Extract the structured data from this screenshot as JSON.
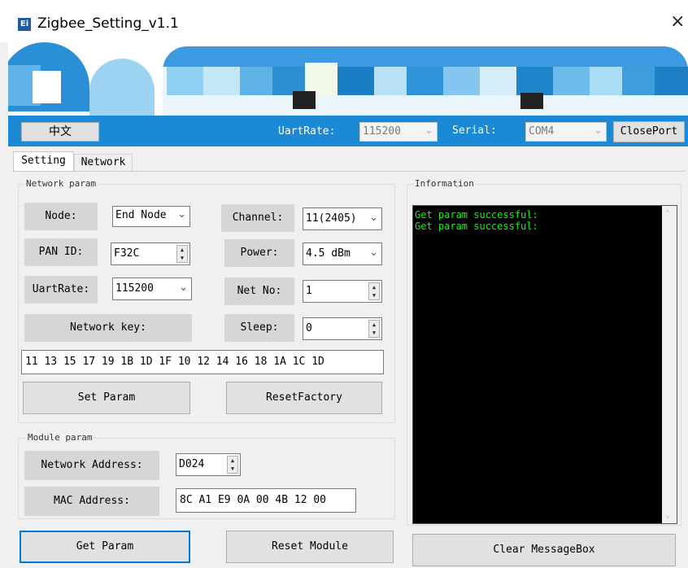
{
  "window": {
    "title": "Zigbee_Setting_v1.1",
    "close_glyph": "×",
    "app_icon": "Ei"
  },
  "toolbar": {
    "language_button": "中文",
    "uartrate_label": "UartRate:",
    "uartrate_value": "115200",
    "serial_label": "Serial:",
    "serial_value": "COM4",
    "close_port_button": "ClosePort",
    "accent": "#1b89d6"
  },
  "tabs": [
    {
      "label": "Setting"
    },
    {
      "label": "Network"
    }
  ],
  "network_param": {
    "title": "Network param",
    "node_label": "Node:",
    "node_value": "End Node",
    "channel_label": "Channel:",
    "channel_value": "11(2405)",
    "panid_label": "PAN ID:",
    "panid_value": "F32C",
    "power_label": "Power:",
    "power_value": "4.5 dBm",
    "uartrate_label": "UartRate:",
    "uartrate_value": "115200",
    "netno_label": "Net No:",
    "netno_value": "1",
    "network_key_label": "Network key:",
    "sleep_label": "Sleep:",
    "sleep_value": "0",
    "network_key_value": "11 13 15 17 19 1B 1D 1F 10 12 14 16 18 1A 1C 1D",
    "set_param_button": "Set Param",
    "reset_factory_button": "ResetFactory"
  },
  "module_param": {
    "title": "Module param",
    "network_address_label": "Network Address:",
    "network_address_value": "D024",
    "mac_address_label": "MAC Address:",
    "mac_address_value": "8C A1 E9 0A 00 4B 12 00"
  },
  "bottom": {
    "get_param_button": "Get Param",
    "reset_module_button": "Reset Module"
  },
  "information": {
    "title": "Information",
    "log_lines": [
      "Get param successful:",
      "Get param successful:"
    ],
    "log_color": "#00ff00",
    "clear_button": "Clear MessageBox"
  }
}
